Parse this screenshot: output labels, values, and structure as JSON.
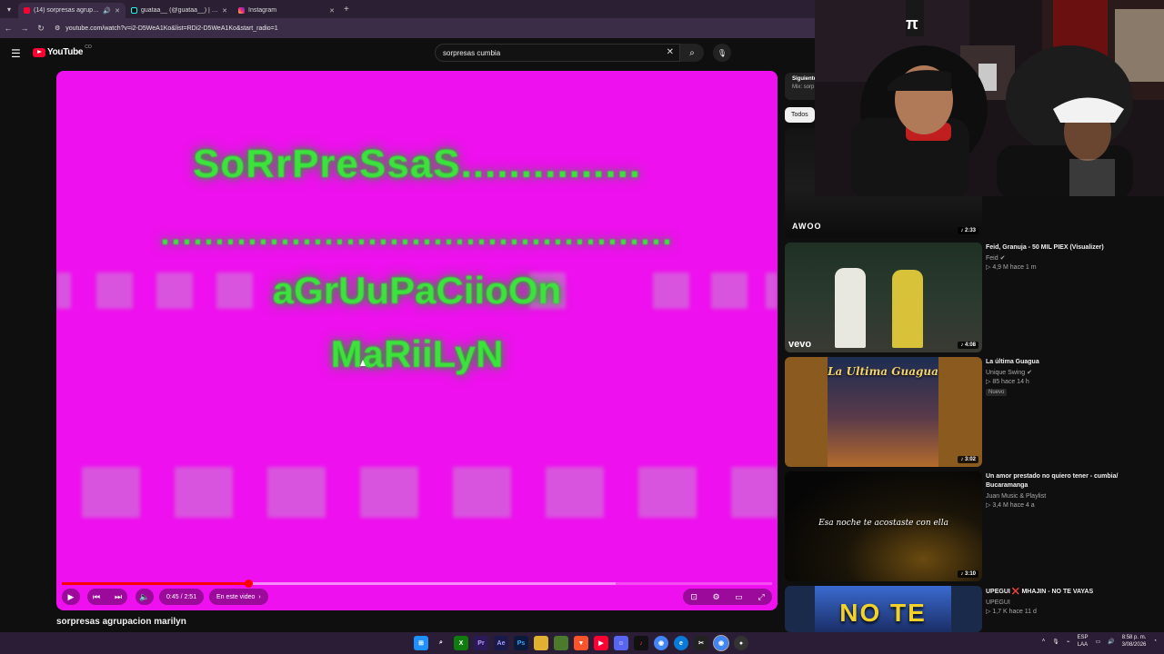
{
  "browser": {
    "tabs": [
      {
        "label": "(14) sorpresas agrupacion ...",
        "active": true,
        "icon": "youtube-icon"
      },
      {
        "label": "guataa__ (@guataa__) | TikTok",
        "active": false,
        "icon": "tiktok-icon"
      },
      {
        "label": "Instagram",
        "active": false,
        "icon": "instagram-icon"
      }
    ],
    "url": "youtube.com/watch?v=i2-D5WeA1Ko&list=RDi2-D5WeA1Ko&start_radio=1"
  },
  "header": {
    "logo_text": "YouTube",
    "region": "CO",
    "search_value": "sorpresas cumbia"
  },
  "video": {
    "lines": [
      "SoRrPreSsaS...............",
      "...............................................",
      "aGrUuPaCiioOn",
      "MaRiiLyN"
    ],
    "time": "0:45 / 2:51",
    "chapter_label": "En este video",
    "progress_fraction": 0.263,
    "buffer_fraction": 0.78,
    "title": "sorpresas agrupacion marilyn"
  },
  "sidebar": {
    "mix_title": "Siguiente",
    "mix_sub": "Mix: sorp",
    "chip": "Todos",
    "items": [
      {
        "duration": "2:33",
        "title": "",
        "channel": "",
        "views": "",
        "badge": "",
        "thumb_label": "AWOO"
      },
      {
        "duration": "4:08",
        "title": "Feid, Granuja - 50 MIL PIEX (Visualizer)",
        "channel": "Feid",
        "views": "4,9 M   hace 1 m",
        "badge": "",
        "thumb_label": "vevo"
      },
      {
        "duration": "3:02",
        "title": "La última Guagua",
        "channel": "Unique Swing",
        "views": "85   hace 14 h",
        "badge": "Nuevo",
        "thumb_label": "La Ultima Guagua"
      },
      {
        "duration": "3:10",
        "title": "Un amor prestado no quiero tener - cumbia/ Bucaramanga",
        "channel": "Juan Music & Playlist",
        "views": "3,4 M   hace 4 a",
        "badge": "",
        "thumb_label": "Esa noche te acostaste con ella"
      },
      {
        "duration": "",
        "title": "UPEGUI ❌ MHAJIN - NO TE VAYAS",
        "channel": "UPEGUI",
        "views": "1,7 K   hace 11 d",
        "badge": "",
        "thumb_label": "NO TE"
      }
    ]
  },
  "taskbar": {
    "lang_top": "ESP",
    "lang_bottom": "LAA",
    "time": "8:58 p. m.",
    "date": "3/08/2026"
  },
  "colors": {
    "player_bg": "#ee10ee",
    "text_green": "#3ce33c",
    "accent_red": "#ff0000"
  }
}
